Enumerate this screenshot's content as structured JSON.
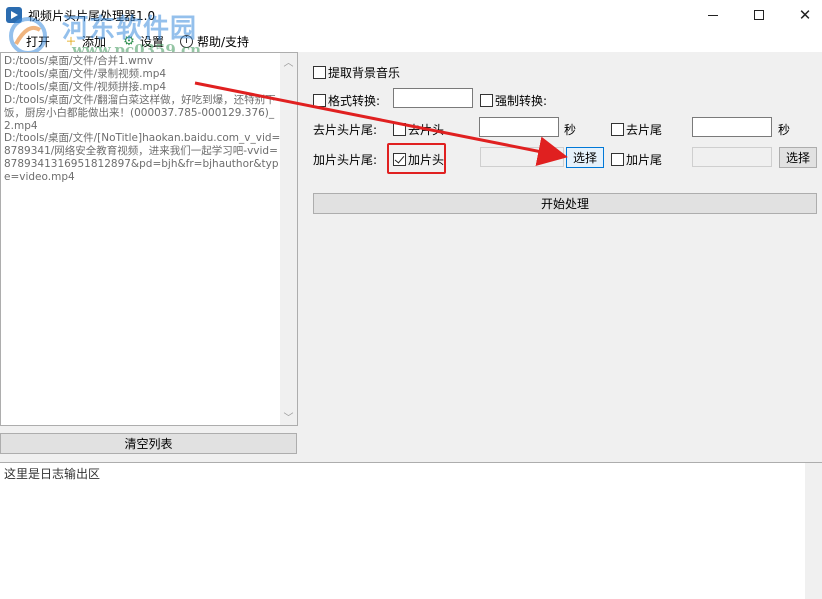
{
  "window": {
    "title": "视频片头片尾处理器1.0"
  },
  "menu": [
    {
      "label": "打开",
      "icon": "folder-open-icon"
    },
    {
      "label": "添加",
      "icon": "add-icon"
    },
    {
      "label": "设置",
      "icon": "gear-icon"
    },
    {
      "label": "帮助/支持",
      "icon": "info-icon"
    }
  ],
  "watermark": {
    "name": "河东软件园",
    "url": "www.pc0359.cn"
  },
  "file_list": [
    "D:/tools/桌面/文件/合并1.wmv",
    "D:/tools/桌面/文件/录制视频.mp4",
    "D:/tools/桌面/文件/视频拼接.mp4",
    "D:/tools/桌面/文件/翻溜白菜这样做，好吃到爆，还特别下饭，厨房小白都能做出来！(000037.785-000129.376)_2.mp4",
    "D:/tools/桌面/文件/[NoTitle]haokan.baidu.com_v_vid=8789341/网络安全教育视频，进来我们一起学习吧-vvid=878934131695181289​7&pd=bjh&fr=bjhauthor&type=video.mp4"
  ],
  "buttons": {
    "clear_list": "清空列表",
    "start": "开始处理",
    "choose": "选择"
  },
  "options": {
    "extract_music": "提取背景音乐",
    "format_convert": "格式转换:",
    "force_convert": "强制转换:",
    "remove_row_label": "去片头片尾:",
    "remove_head": "去片头",
    "remove_tail": "去片尾",
    "seconds": "秒",
    "add_row_label": "加片头片尾:",
    "add_head": "加片头",
    "add_tail": "加片尾"
  },
  "checkbox_state": {
    "add_head": true
  },
  "log": {
    "placeholder": "这里是日志输出区"
  },
  "colors": {
    "annotation": "#e02020",
    "watermark_blue": "#3c8cdc"
  }
}
